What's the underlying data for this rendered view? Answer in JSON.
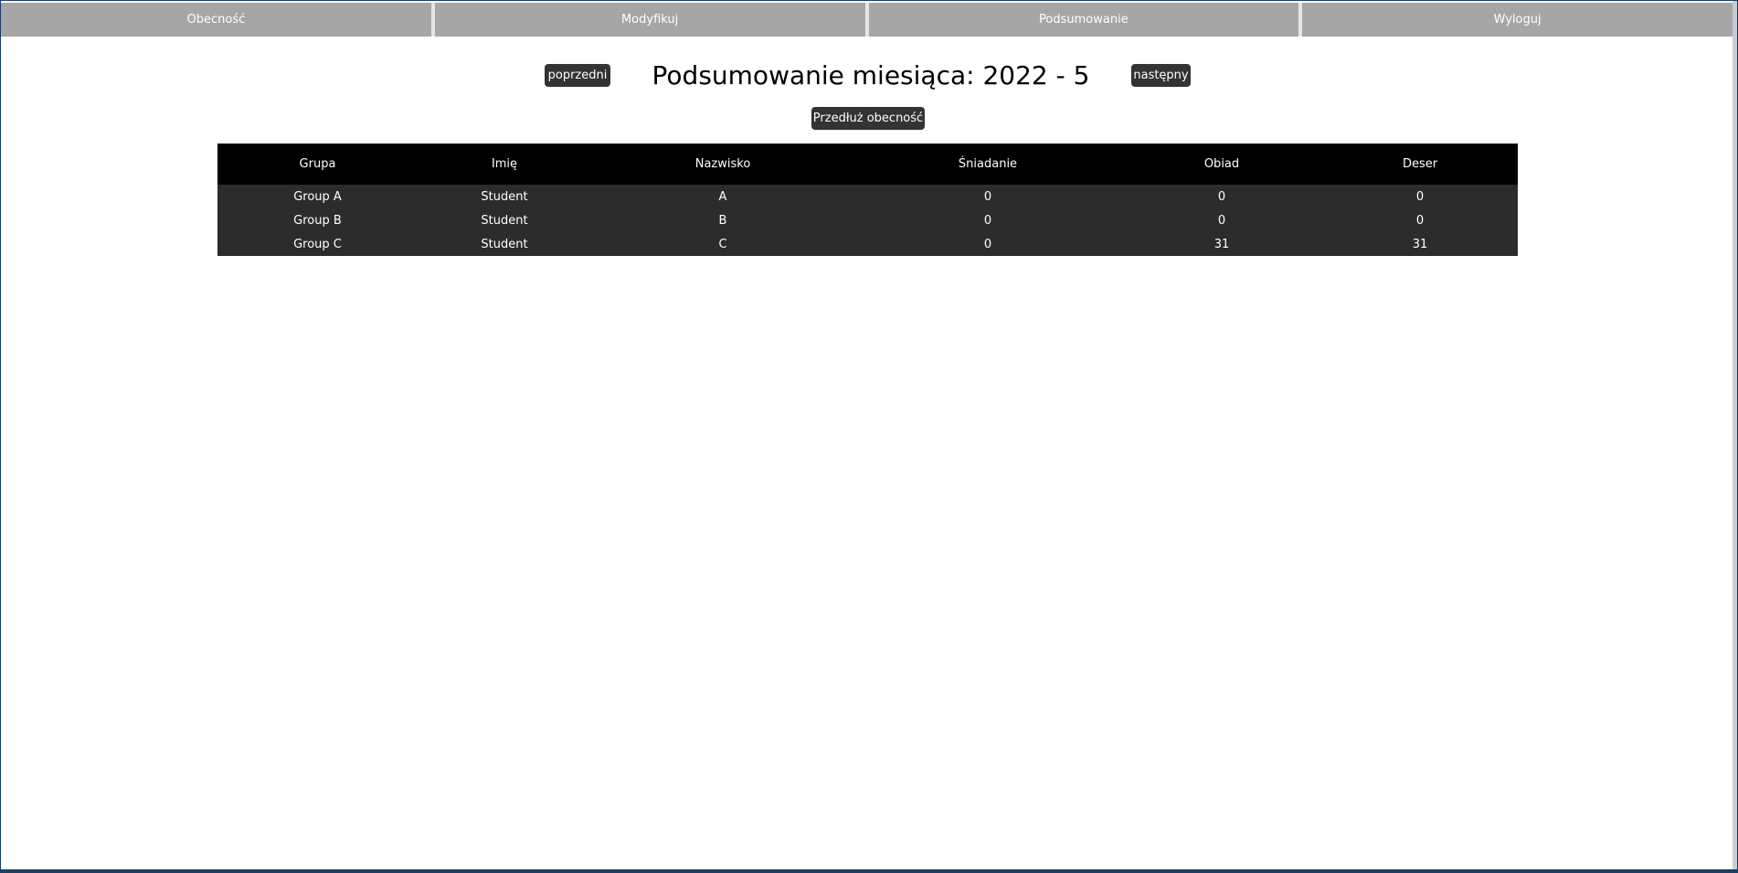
{
  "nav": {
    "items": [
      {
        "label": "Obecność"
      },
      {
        "label": "Modyfikuj"
      },
      {
        "label": "Podsumowanie"
      },
      {
        "label": "Wyloguj"
      }
    ]
  },
  "header": {
    "prev_label": "poprzedni",
    "title": "Podsumowanie miesiąca: 2022 - 5",
    "next_label": "następny",
    "extend_label": "Przedłuż obecność"
  },
  "table": {
    "columns": [
      "Grupa",
      "Imię",
      "Nazwisko",
      "Śniadanie",
      "Obiad",
      "Deser"
    ],
    "rows": [
      [
        "Group A",
        "Student",
        "A",
        "0",
        "0",
        "0"
      ],
      [
        "Group B",
        "Student",
        "B",
        "0",
        "0",
        "0"
      ],
      [
        "Group C",
        "Student",
        "C",
        "0",
        "31",
        "31"
      ]
    ]
  },
  "colors": {
    "nav_background": "#a6a6a6",
    "button_background": "#333333",
    "table_header_background": "#000000",
    "table_row_background": "#2c2c2c"
  }
}
